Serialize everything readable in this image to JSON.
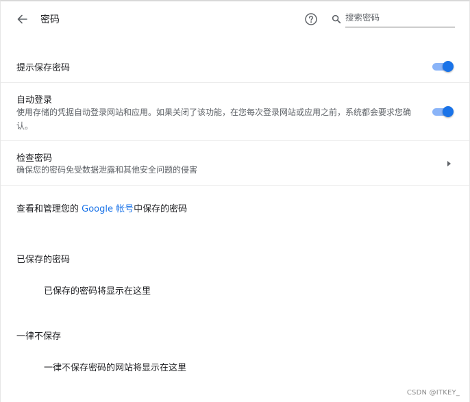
{
  "header": {
    "title": "密码",
    "search_placeholder": "搜索密码"
  },
  "offer_to_save": {
    "label": "提示保存密码",
    "enabled": true
  },
  "auto_signin": {
    "label": "自动登录",
    "description": "使用存储的凭据自动登录网站和应用。如果关闭了该功能，在您每次登录网站或应用之前，系统都会要求您确认。",
    "enabled": true
  },
  "check_passwords": {
    "label": "检查密码",
    "description": "确保您的密码免受数据泄露和其他安全问题的侵害"
  },
  "manage_account": {
    "prefix": "查看和管理您的 ",
    "link": "Google 帐号",
    "suffix": "中保存的密码"
  },
  "saved_passwords": {
    "heading": "已保存的密码",
    "empty_text": "已保存的密码将显示在这里"
  },
  "never_saved": {
    "heading": "一律不保存",
    "empty_text": "一律不保存密码的网站将显示在这里"
  },
  "watermark": "CSDN @ITKEY_",
  "colors": {
    "accent": "#1a73e8",
    "toggle_track": "#8ab4f8",
    "secondary_text": "#5f6368"
  },
  "icons": {
    "back": "arrow-left",
    "help": "question-circle",
    "search": "magnifier",
    "submenu": "triangle-right"
  }
}
